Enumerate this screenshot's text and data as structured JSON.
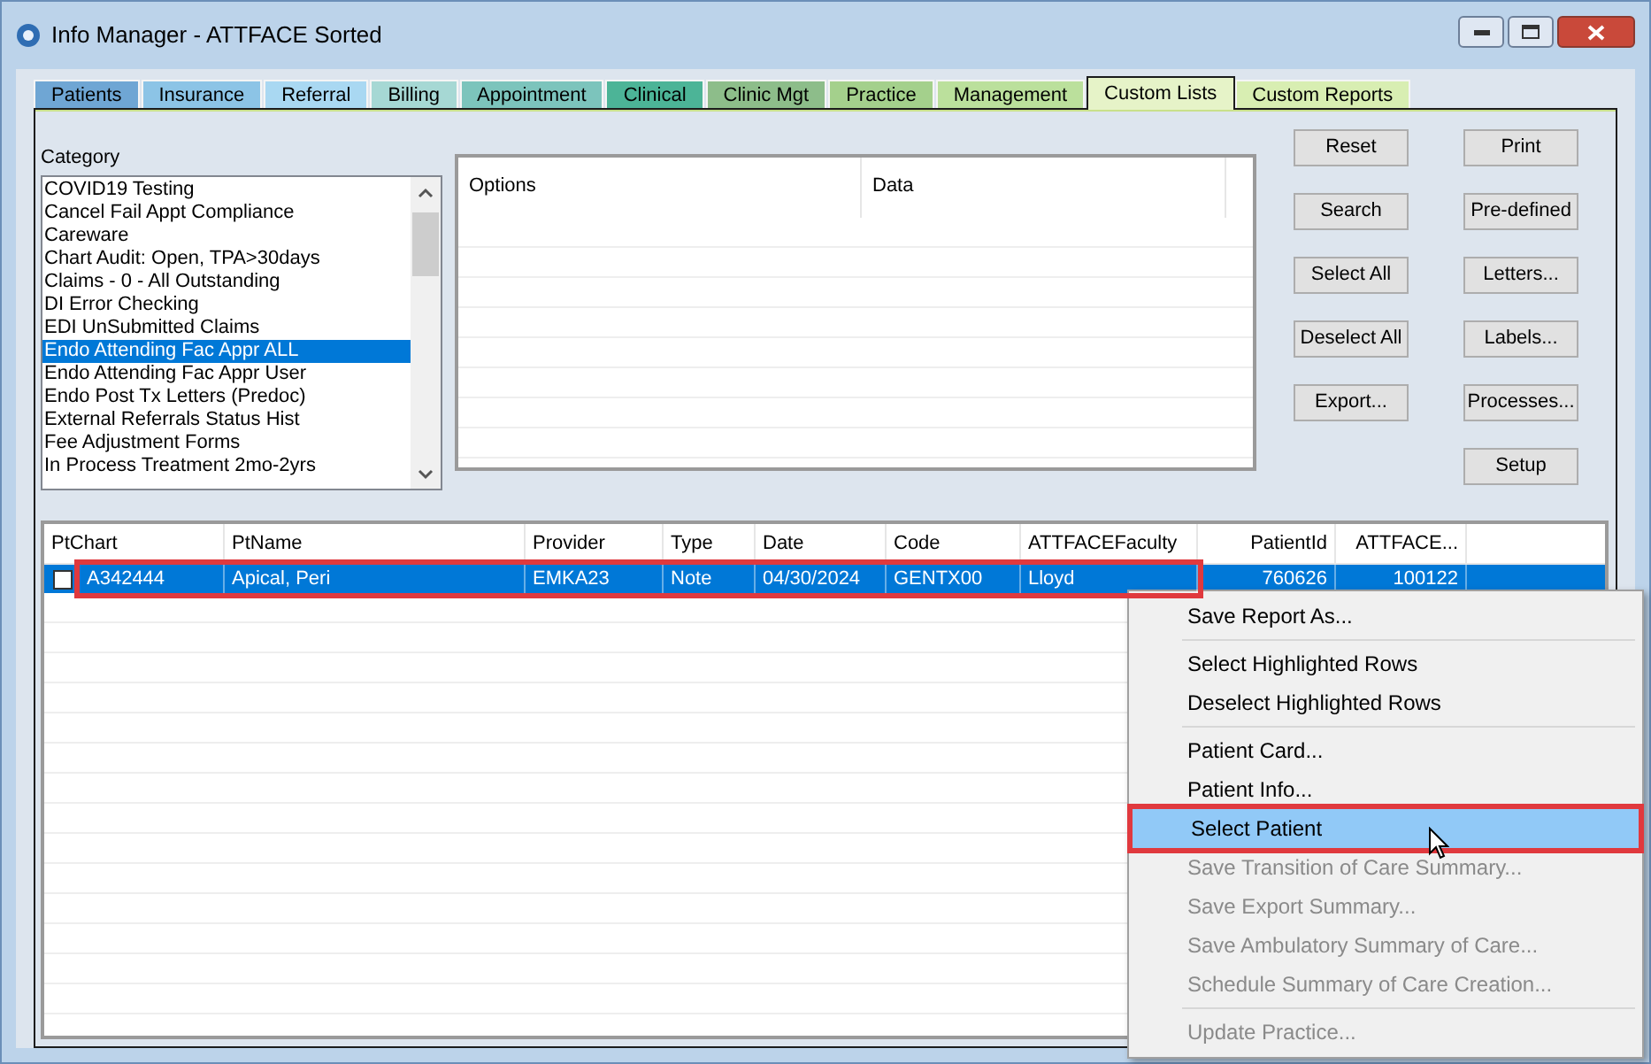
{
  "window": {
    "title": "Info Manager - ATTFACE Sorted"
  },
  "tabs": [
    {
      "label": "Patients",
      "selected": false,
      "color": "#6fa6d4"
    },
    {
      "label": "Insurance",
      "selected": false,
      "color": "#8cc4e6"
    },
    {
      "label": "Referral",
      "selected": false,
      "color": "#a9d8f2"
    },
    {
      "label": "Billing",
      "selected": false,
      "color": "#a6d8d4"
    },
    {
      "label": "Appointment",
      "selected": false,
      "color": "#7cc4bc"
    },
    {
      "label": "Clinical",
      "selected": false,
      "color": "#4cb497"
    },
    {
      "label": "Clinic Mgt",
      "selected": false,
      "color": "#8dbd8a"
    },
    {
      "label": "Practice",
      "selected": false,
      "color": "#a4d08c"
    },
    {
      "label": "Management",
      "selected": false,
      "color": "#bbe09c"
    },
    {
      "label": "Custom Lists",
      "selected": true,
      "color": "#e6f3c8"
    },
    {
      "label": "Custom Reports",
      "selected": false,
      "color": "#d8eeb2"
    }
  ],
  "category": {
    "label": "Category",
    "items": [
      {
        "label": "COVID19 Testing",
        "selected": false
      },
      {
        "label": "Cancel Fail Appt Compliance",
        "selected": false
      },
      {
        "label": "Careware",
        "selected": false
      },
      {
        "label": "Chart Audit: Open, TPA>30days",
        "selected": false
      },
      {
        "label": "Claims - 0 - All Outstanding",
        "selected": false
      },
      {
        "label": "DI Error Checking",
        "selected": false
      },
      {
        "label": "EDI UnSubmitted Claims",
        "selected": false
      },
      {
        "label": "Endo Attending Fac Appr ALL",
        "selected": true
      },
      {
        "label": "Endo Attending Fac Appr User",
        "selected": false
      },
      {
        "label": "Endo Post Tx Letters (Predoc)",
        "selected": false
      },
      {
        "label": "External Referrals Status Hist",
        "selected": false
      },
      {
        "label": "Fee Adjustment Forms",
        "selected": false
      },
      {
        "label": "In Process Treatment 2mo-2yrs",
        "selected": false
      }
    ]
  },
  "options_grid": {
    "columns": [
      "Options",
      "Data"
    ]
  },
  "buttons_left": [
    "Reset",
    "Search",
    "Select All",
    "Deselect All",
    "Export..."
  ],
  "buttons_right": [
    "Print",
    "Pre-defined",
    "Letters...",
    "Labels...",
    "Processes...",
    "Setup"
  ],
  "table": {
    "columns": [
      "PtChart",
      "PtName",
      "Provider",
      "Type",
      "Date",
      "Code",
      "ATTFACEFaculty",
      "PatientId",
      "ATTFACE..."
    ],
    "rows": [
      {
        "checked": false,
        "selected": true,
        "annotated": true,
        "cells": [
          "A342444",
          "Apical, Peri",
          "EMKA23",
          "Note",
          "04/30/2024",
          "GENTX00",
          "Lloyd",
          "760626",
          "100122"
        ]
      }
    ]
  },
  "context_menu": [
    {
      "kind": "item",
      "label": "Save Report As...",
      "disabled": false,
      "selected": false
    },
    {
      "kind": "separator"
    },
    {
      "kind": "item",
      "label": "Select Highlighted Rows",
      "disabled": false,
      "selected": false
    },
    {
      "kind": "item",
      "label": "Deselect Highlighted Rows",
      "disabled": false,
      "selected": false
    },
    {
      "kind": "separator"
    },
    {
      "kind": "item",
      "label": "Patient Card...",
      "disabled": false,
      "selected": false
    },
    {
      "kind": "item",
      "label": "Patient Info...",
      "disabled": false,
      "selected": false
    },
    {
      "kind": "item",
      "label": "Select Patient",
      "disabled": false,
      "selected": true
    },
    {
      "kind": "item",
      "label": "Save Transition of Care Summary...",
      "disabled": true,
      "selected": false
    },
    {
      "kind": "item",
      "label": "Save Export Summary...",
      "disabled": true,
      "selected": false
    },
    {
      "kind": "item",
      "label": "Save Ambulatory Summary of Care...",
      "disabled": true,
      "selected": false
    },
    {
      "kind": "item",
      "label": "Schedule Summary of Care Creation...",
      "disabled": true,
      "selected": false
    },
    {
      "kind": "separator"
    },
    {
      "kind": "item",
      "label": "Update Practice...",
      "disabled": true,
      "selected": false
    }
  ]
}
